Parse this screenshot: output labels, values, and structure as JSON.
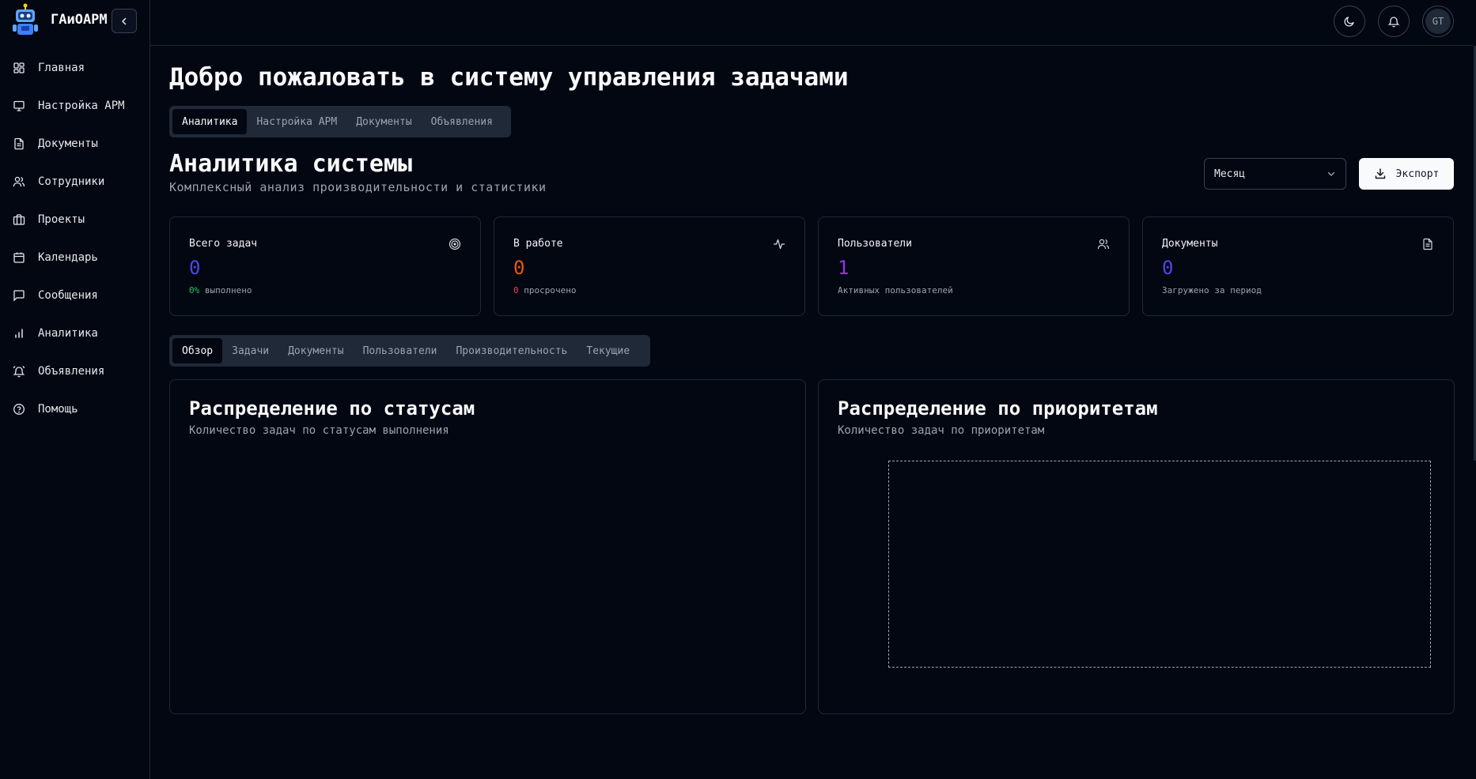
{
  "app": {
    "name": "ГАиОАРМ"
  },
  "sidebar": {
    "items": [
      {
        "label": "Главная",
        "icon": "dashboard-grid-icon"
      },
      {
        "label": "Настройка АРМ",
        "icon": "monitor-icon"
      },
      {
        "label": "Документы",
        "icon": "file-text-icon"
      },
      {
        "label": "Сотрудники",
        "icon": "users-icon"
      },
      {
        "label": "Проекты",
        "icon": "briefcase-icon"
      },
      {
        "label": "Календарь",
        "icon": "calendar-icon"
      },
      {
        "label": "Сообщения",
        "icon": "message-square-icon"
      },
      {
        "label": "Аналитика",
        "icon": "bar-chart-icon"
      },
      {
        "label": "Объявления",
        "icon": "bell-ring-icon"
      },
      {
        "label": "Помощь",
        "icon": "help-circle-icon"
      }
    ]
  },
  "topbar": {
    "avatar_initials": "GT"
  },
  "page": {
    "welcome": "Добро пожаловать в систему управления задачами",
    "tabs": [
      "Аналитика",
      "Настройка АРМ",
      "Документы",
      "Объявления"
    ],
    "section_title": "Аналитика системы",
    "section_subtitle": "Комплексный анализ производительности и статистики",
    "period_select": "Месяц",
    "export_label": "Экспорт"
  },
  "cards": [
    {
      "label": "Всего задач",
      "value": "0",
      "foot_accent": "0%",
      "foot_text": "выполнено",
      "value_color": "#4f46e5",
      "accent_color": "#22c55e",
      "icon": "target-icon"
    },
    {
      "label": "В работе",
      "value": "0",
      "foot_accent": "0",
      "foot_text": "просрочено",
      "value_color": "#ea580c",
      "accent_color": "#ef4444",
      "icon": "activity-icon"
    },
    {
      "label": "Пользователи",
      "value": "1",
      "foot_accent": "",
      "foot_text": "Активных пользователей",
      "value_color": "#9333ea",
      "accent_color": "",
      "icon": "users-icon"
    },
    {
      "label": "Документы",
      "value": "0",
      "foot_accent": "",
      "foot_text": "Загружено за период",
      "value_color": "#4f46e5",
      "accent_color": "",
      "icon": "file-icon"
    }
  ],
  "subtabs": [
    "Обзор",
    "Задачи",
    "Документы",
    "Пользователи",
    "Производительность",
    "Текущие"
  ],
  "panels": [
    {
      "title": "Распределение по статусам",
      "subtitle": "Количество задач по статусам выполнения"
    },
    {
      "title": "Распределение по приоритетам",
      "subtitle": "Количество задач по приоритетам"
    }
  ]
}
